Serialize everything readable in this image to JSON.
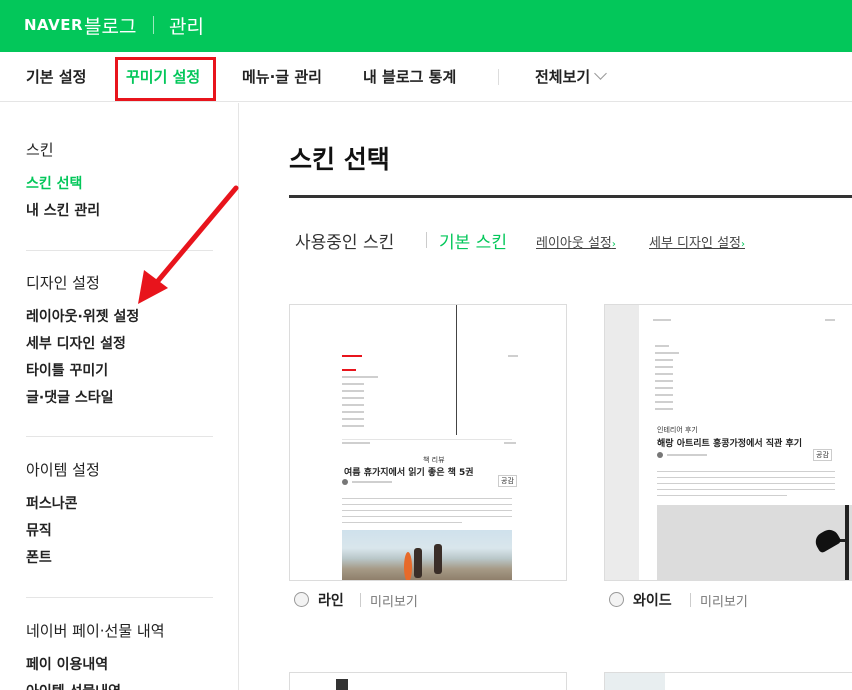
{
  "header": {
    "brand": "NAVER",
    "service": "블로그",
    "section": "관리",
    "bg_color": "#03c75a"
  },
  "nav": {
    "tabs": [
      {
        "label": "기본 설정"
      },
      {
        "label": "꾸미기 설정"
      },
      {
        "label": "메뉴·글 관리"
      },
      {
        "label": "내 블로그 통계"
      },
      {
        "label": "전체보기"
      }
    ],
    "active_index": 1
  },
  "sidebar": {
    "groups": [
      {
        "title": "스킨",
        "items": [
          {
            "label": "스킨 선택"
          },
          {
            "label": "내 스킨 관리"
          }
        ]
      },
      {
        "title": "디자인 설정",
        "items": [
          {
            "label": "레이아웃·위젯 설정"
          },
          {
            "label": "세부 디자인 설정"
          },
          {
            "label": "타이틀 꾸미기"
          },
          {
            "label": "글·댓글 스타일"
          }
        ]
      },
      {
        "title": "아이템 설정",
        "items": [
          {
            "label": "퍼스나콘"
          },
          {
            "label": "뮤직"
          },
          {
            "label": "폰트"
          }
        ]
      },
      {
        "title": "네이버 페이·선물 내역",
        "items": [
          {
            "label": "페이 이용내역"
          },
          {
            "label": "아이템 선물내역"
          }
        ]
      }
    ]
  },
  "main": {
    "title": "스킨 선택",
    "subtabs": [
      {
        "label": "사용중인 스킨"
      },
      {
        "label": "기본 스킨"
      },
      {
        "label": "레이아웃 설정"
      },
      {
        "label": "세부 디자인 설정"
      }
    ],
    "skins": [
      {
        "name": "라인",
        "preview_label": "미리보기",
        "post_title": "여름 휴가지에서 읽기 좋은 책 5권",
        "category": "책 리뷰",
        "button": "공감"
      },
      {
        "name": "와이드",
        "preview_label": "미리보기",
        "post_title": "해랑 아트리트 홍콩가정에서 직관 후기",
        "category": "인테리어 후기",
        "button": "공감"
      }
    ]
  },
  "colors": {
    "accent": "#03c75a",
    "highlight": "#e8141c"
  }
}
